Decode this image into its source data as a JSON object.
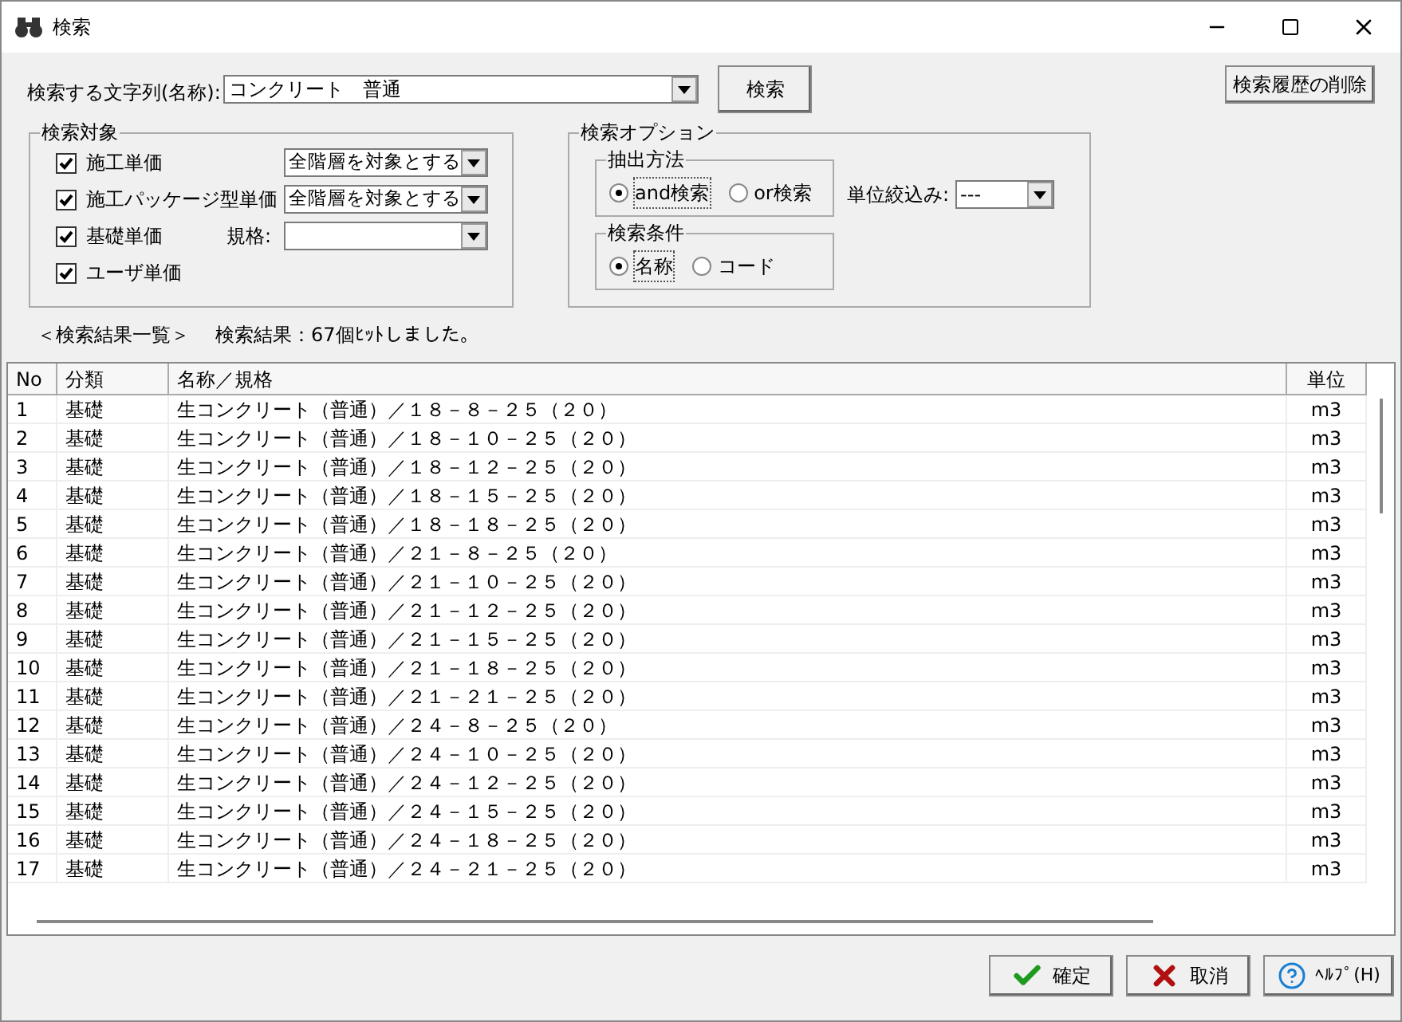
{
  "window": {
    "title": "検索"
  },
  "search": {
    "label": "検索する文字列(名称):",
    "value": "コンクリート　普通",
    "button": "検索",
    "clear_history_button": "検索履歴の削除"
  },
  "targets": {
    "title": "検索対象",
    "items": [
      {
        "kind": "select",
        "label": "施工単価",
        "checked": true,
        "value": "全階層を対象とする"
      },
      {
        "kind": "select",
        "label": "施工パッケージ型単価",
        "checked": true,
        "value": "全階層を対象とする"
      },
      {
        "kind": "spec",
        "label": "基礎単価",
        "checked": true,
        "spec_label": "規格:"
      },
      {
        "kind": "plain",
        "label": "ユーザ単価",
        "checked": true
      }
    ]
  },
  "options": {
    "title": "検索オプション",
    "method": {
      "title": "抽出方法",
      "choices": [
        {
          "label": "and検索",
          "selected": true
        },
        {
          "label": "or検索",
          "selected": false
        }
      ]
    },
    "condition": {
      "title": "検索条件",
      "choices": [
        {
          "label": "名称",
          "selected": true
        },
        {
          "label": "コード",
          "selected": false
        }
      ]
    },
    "unit_filter": {
      "label": "単位絞込み:",
      "value": "---"
    }
  },
  "results_heading": "＜検索結果一覧＞",
  "results_count": "検索結果：67個ﾋｯﾄしました。",
  "table": {
    "columns": [
      "No",
      "分類",
      "名称／規格",
      "単位"
    ],
    "rows": [
      [
        "1",
        "基礎",
        "生コンクリート（普通）／１８－８－２５（２０）",
        "m3"
      ],
      [
        "2",
        "基礎",
        "生コンクリート（普通）／１８－１０－２５（２０）",
        "m3"
      ],
      [
        "3",
        "基礎",
        "生コンクリート（普通）／１８－１２－２５（２０）",
        "m3"
      ],
      [
        "4",
        "基礎",
        "生コンクリート（普通）／１８－１５－２５（２０）",
        "m3"
      ],
      [
        "5",
        "基礎",
        "生コンクリート（普通）／１８－１８－２５（２０）",
        "m3"
      ],
      [
        "6",
        "基礎",
        "生コンクリート（普通）／２１－８－２５（２０）",
        "m3"
      ],
      [
        "7",
        "基礎",
        "生コンクリート（普通）／２１－１０－２５（２０）",
        "m3"
      ],
      [
        "8",
        "基礎",
        "生コンクリート（普通）／２１－１２－２５（２０）",
        "m3"
      ],
      [
        "9",
        "基礎",
        "生コンクリート（普通）／２１－１５－２５（２０）",
        "m3"
      ],
      [
        "10",
        "基礎",
        "生コンクリート（普通）／２１－１８－２５（２０）",
        "m3"
      ],
      [
        "11",
        "基礎",
        "生コンクリート（普通）／２１－２１－２５（２０）",
        "m3"
      ],
      [
        "12",
        "基礎",
        "生コンクリート（普通）／２４－８－２５（２０）",
        "m3"
      ],
      [
        "13",
        "基礎",
        "生コンクリート（普通）／２４－１０－２５（２０）",
        "m3"
      ],
      [
        "14",
        "基礎",
        "生コンクリート（普通）／２４－１２－２５（２０）",
        "m3"
      ],
      [
        "15",
        "基礎",
        "生コンクリート（普通）／２４－１５－２５（２０）",
        "m3"
      ],
      [
        "16",
        "基礎",
        "生コンクリート（普通）／２４－１８－２５（２０）",
        "m3"
      ],
      [
        "17",
        "基礎",
        "生コンクリート（普通）／２４－２１－２５（２０）",
        "m3"
      ]
    ]
  },
  "buttons": [
    {
      "kind": "ok",
      "label": "確定"
    },
    {
      "kind": "cancel",
      "label": "取消"
    },
    {
      "kind": "help",
      "label": "ﾍﾙﾌﾟ(H)"
    }
  ]
}
